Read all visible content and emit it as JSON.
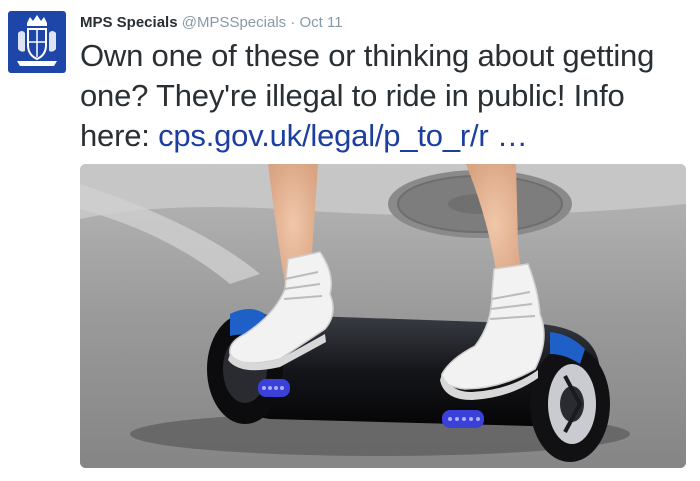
{
  "tweet": {
    "display_name": "MPS Specials",
    "handle": "@MPSSpecials",
    "separator": "·",
    "date": "Oct 11",
    "text_before_link": "Own one of these or thinking about getting one? They're illegal to ride in public! Info here: ",
    "link_text": "cps.gov.uk/legal/p_to_r/r …"
  },
  "colors": {
    "avatar_bg": "#1d46a8",
    "link": "#1b3ea0",
    "name": "#292f33",
    "meta": "#8899a6"
  },
  "icons": {
    "avatar": "crest-icon"
  }
}
